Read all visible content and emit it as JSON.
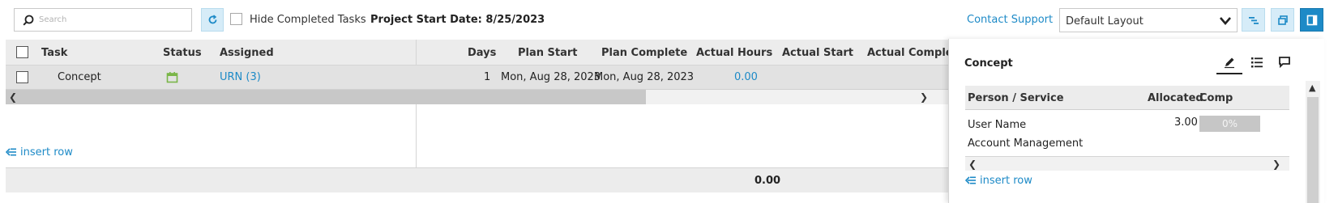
{
  "toolbar": {
    "search_placeholder": "Search",
    "hide_completed_label": "Hide Completed Tasks",
    "hide_completed_checked": false,
    "project_start_label": "Project Start Date: 8/25/2023",
    "contact_support": "Contact Support",
    "layout_value": "Default Layout",
    "accent_color": "#1d8ac7"
  },
  "grid": {
    "columns": {
      "task": "Task",
      "status": "Status",
      "assigned": "Assigned",
      "days": "Days",
      "plan_start": "Plan Start",
      "plan_complete": "Plan Complete",
      "actual_hours": "Actual Hours",
      "actual_start": "Actual Start",
      "actual_complete": "Actual Complet"
    },
    "rows": [
      {
        "task": "Concept",
        "status_icon": "calendar-icon",
        "assigned": "URN (3)",
        "days": "1",
        "plan_start": "Mon, Aug 28, 2023",
        "plan_complete": "Mon, Aug 28, 2023",
        "actual_hours": "0.00"
      }
    ],
    "insert_row": "insert row",
    "total_actual_hours": "0.00"
  },
  "panel": {
    "title": "Concept",
    "tabs": [
      "pencil-icon",
      "list-icon",
      "comment-icon"
    ],
    "active_tab": "pencil-icon",
    "columns": {
      "person": "Person / Service",
      "allocated": "Allocated",
      "comp": "Comp"
    },
    "rows": [
      {
        "person": "User Name",
        "allocated": "3.00",
        "comp": "0%",
        "comp_fraction": 0
      },
      {
        "person": "Account Management"
      }
    ],
    "insert_row": "insert row"
  }
}
